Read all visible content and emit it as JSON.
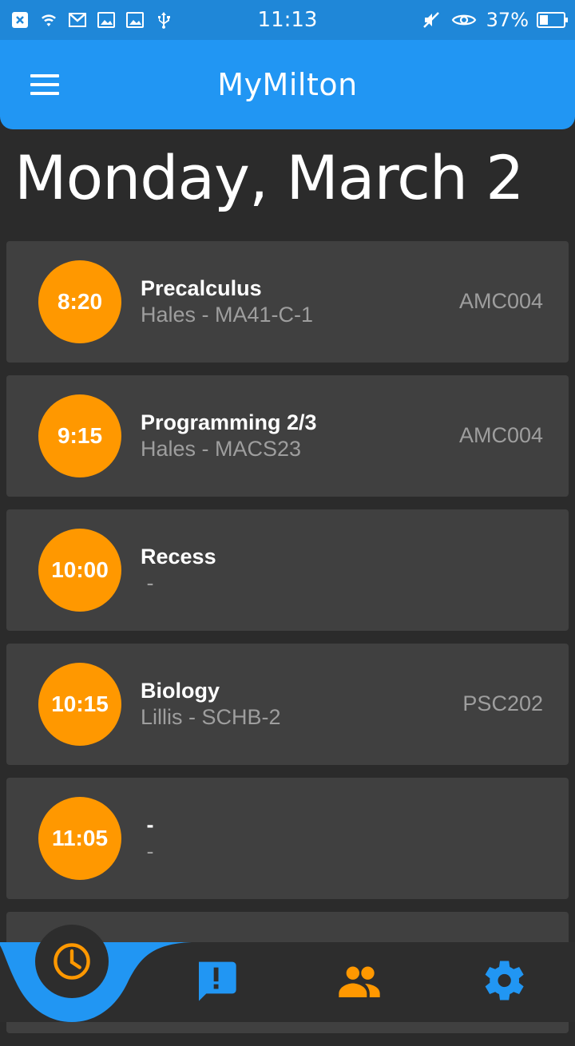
{
  "status_bar": {
    "time": "11:13",
    "battery_text": "37%",
    "battery_level": 0.37,
    "left_icons": [
      "close-notification-icon",
      "wifi-icon",
      "gmail-icon",
      "image-icon",
      "image-icon",
      "usb-icon"
    ],
    "right_icons": [
      "mute-icon",
      "eye-icon",
      "battery-icon"
    ]
  },
  "app_bar": {
    "title": "MyMilton",
    "menu_icon": "menu-icon"
  },
  "date_heading": "Monday, March 2",
  "schedule": [
    {
      "time": "8:20",
      "title": "Precalculus",
      "subtitle": "Hales - MA41-C-1",
      "room": "AMC004"
    },
    {
      "time": "9:15",
      "title": "Programming 2/3",
      "subtitle": "Hales - MACS23",
      "room": "AMC004"
    },
    {
      "time": "10:00",
      "title": "Recess",
      "subtitle": " -",
      "room": ""
    },
    {
      "time": "10:15",
      "title": "Biology",
      "subtitle": "Lillis - SCHB-2",
      "room": "PSC202"
    },
    {
      "time": "11:05",
      "title": " -",
      "subtitle": " -",
      "room": ""
    }
  ],
  "bottom_nav": {
    "items": [
      {
        "icon": "clock-icon",
        "active": true
      },
      {
        "icon": "announcement-icon",
        "active": false
      },
      {
        "icon": "people-icon",
        "active": false
      },
      {
        "icon": "settings-icon",
        "active": false
      }
    ]
  },
  "colors": {
    "primary": "#2196f3",
    "status_bar": "#1f87d8",
    "accent": "#ff9800",
    "background": "#2b2b2b",
    "card": "#404040",
    "secondary_text": "#9e9e9e"
  }
}
